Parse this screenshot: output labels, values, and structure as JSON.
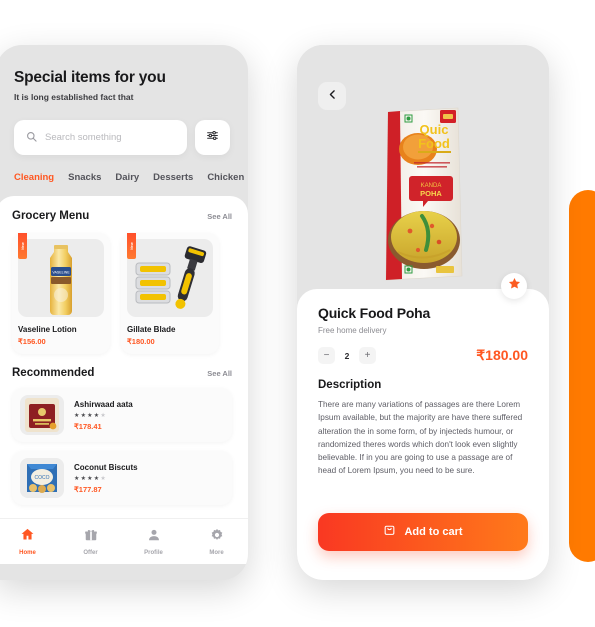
{
  "left_phone": {
    "header": {
      "title": "Special items for you",
      "subtitle": "It is long established fact that"
    },
    "search": {
      "placeholder": "Search something",
      "icon": "search-icon",
      "filter_icon": "sliders-icon"
    },
    "categories": [
      {
        "label": "Cleaning",
        "active": true
      },
      {
        "label": "Snacks",
        "active": false
      },
      {
        "label": "Dairy",
        "active": false
      },
      {
        "label": "Desserts",
        "active": false
      },
      {
        "label": "Chicken",
        "active": false
      }
    ],
    "grocery_section": {
      "title": "Grocery Menu",
      "see_all": "See All",
      "badge_label": "New",
      "items": [
        {
          "name": "Vaseline Lotion",
          "price": "₹156.00"
        },
        {
          "name": "Gillate Blade",
          "price": "₹180.00"
        }
      ]
    },
    "recommended_section": {
      "title": "Recommended",
      "see_all": "See All",
      "items": [
        {
          "name": "Ashirwaad aata",
          "price": "₹178.41",
          "rating": 4
        },
        {
          "name": "Coconut Biscuts",
          "price": "₹177.87",
          "rating": 4
        }
      ]
    },
    "tabbar": [
      {
        "label": "Home",
        "icon": "home-icon",
        "active": true
      },
      {
        "label": "Offer",
        "icon": "gift-icon",
        "active": false
      },
      {
        "label": "Profile",
        "icon": "person-icon",
        "active": false
      },
      {
        "label": "More",
        "icon": "gear-icon",
        "active": false
      }
    ]
  },
  "right_phone": {
    "back_icon": "chevron-left-icon",
    "favorite_icon": "star-icon",
    "product": {
      "name": "Quick Food Poha",
      "delivery": "Free home delivery",
      "quantity": "2",
      "price": "₹180.00",
      "minus": "−",
      "plus": "+",
      "package_brand_line1": "Quic",
      "package_brand_line2": "Food",
      "package_variant_line1": "KANDA",
      "package_variant_line2": "POHA"
    },
    "description": {
      "title": "Description",
      "body": "There are many variations of passages are there Lorem Ipsum available, but the majority are have there suffered alteration the  in some form, of by injecteds humour, or randomized theres words which don't look even slightly believable. If in you are going to use a passage are of head of Lorem Ipsum, you need to be sure."
    },
    "cart_button": {
      "label": "Add to cart",
      "icon": "bag-icon"
    }
  },
  "colors": {
    "accent": "#FF5722",
    "gradient_start": "#F93822",
    "gradient_end": "#FF7A1A",
    "deco_orange": "#FF7A00"
  }
}
